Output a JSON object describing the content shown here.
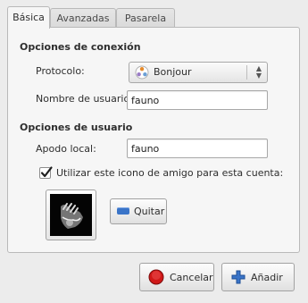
{
  "tabs": [
    {
      "label": "Básica",
      "active": true
    },
    {
      "label": "Avanzadas",
      "active": false
    },
    {
      "label": "Pasarela",
      "active": false
    }
  ],
  "connection": {
    "title": "Opciones de conexión",
    "protocol_label": "Protocolo:",
    "protocol_value": "Bonjour",
    "protocol_icon": "bonjour-icon",
    "username_label": "Nombre de usuario:",
    "username_value": "fauno"
  },
  "user": {
    "title": "Opciones de usuario",
    "alias_label": "Apodo local:",
    "alias_value": "fauno",
    "buddy_icon_checkbox_label": "Utilizar este icono de amigo para esta cuenta:",
    "buddy_icon_checked": true,
    "remove_label": "Quitar"
  },
  "footer": {
    "cancel_label": "Cancelar",
    "add_label": "Añadir"
  },
  "colors": {
    "cancel_icon": "#d01818",
    "add_icon": "#3a74c8",
    "remove_icon": "#3a74c8"
  }
}
